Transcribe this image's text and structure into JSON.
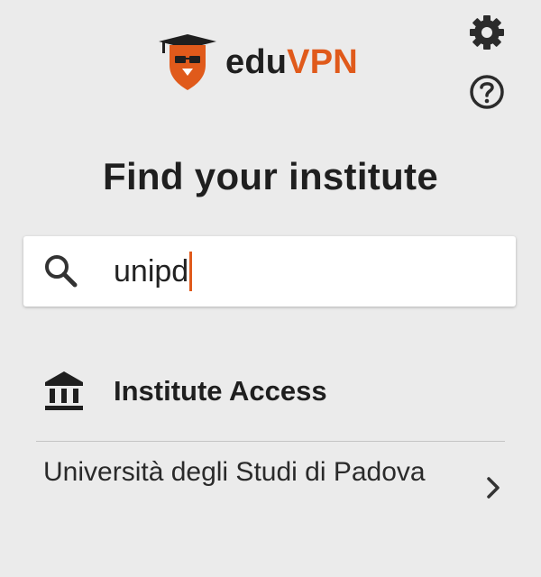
{
  "app": {
    "logo_text_part1": "edu",
    "logo_text_part2": "VPN",
    "brand_color": "#e05a1b"
  },
  "toolbar": {
    "settings_icon": "gear-icon",
    "help_icon": "help-circle-icon"
  },
  "page": {
    "title": "Find your institute"
  },
  "search": {
    "icon": "search-icon",
    "value": "unipd"
  },
  "section": {
    "icon": "institution-icon",
    "label": "Institute Access"
  },
  "results": [
    {
      "label": "Università degli Studi di Padova",
      "icon": "chevron-right-icon"
    }
  ]
}
